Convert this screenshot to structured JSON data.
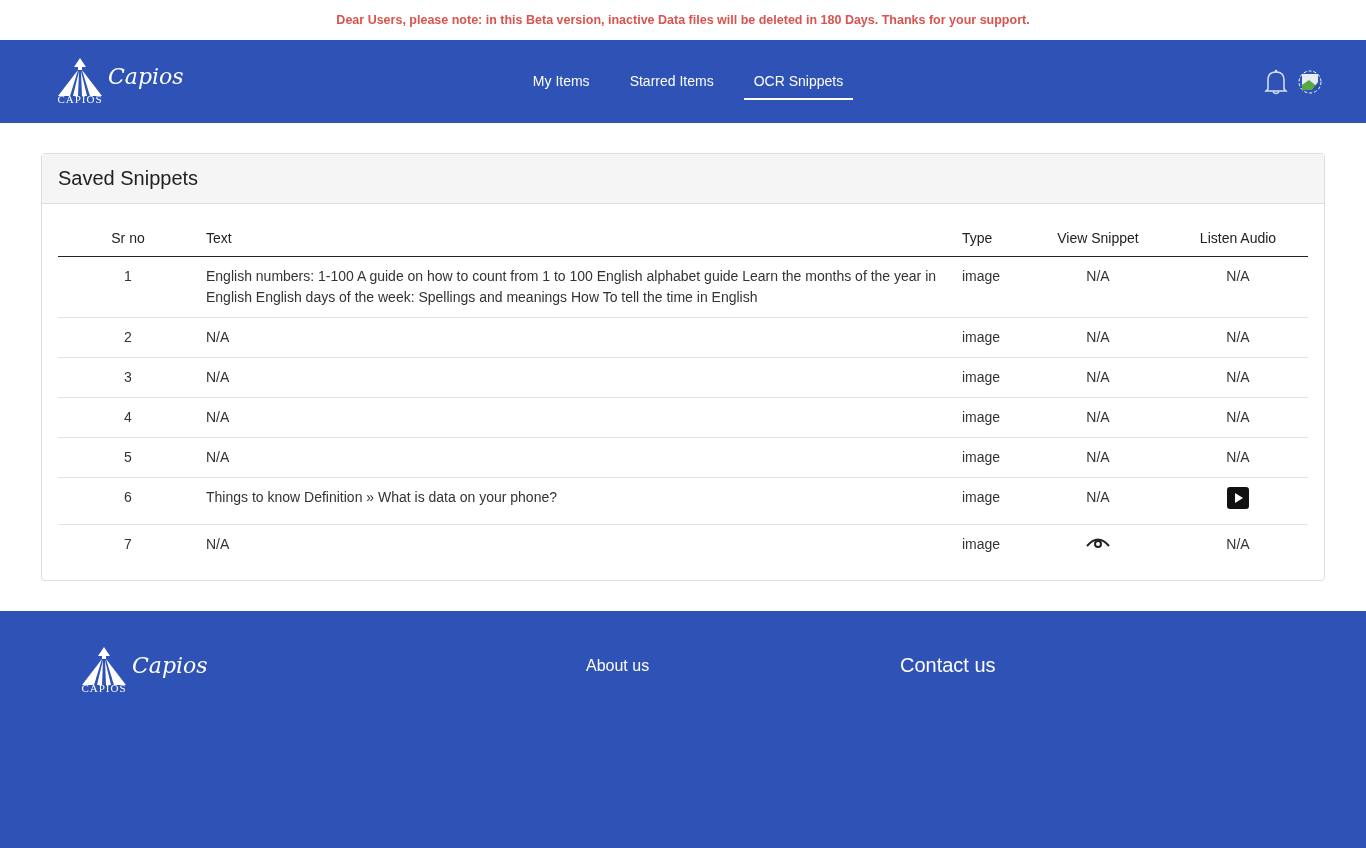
{
  "notice": "Dear Users, please note: in this Beta version, inactive Data files will be deleted in 180 Days. Thanks for your support.",
  "header": {
    "logo": {
      "caption": "CAPIOS",
      "script": "Capios"
    },
    "nav": [
      {
        "label": "My Items",
        "selected": false
      },
      {
        "label": "Starred Items",
        "selected": false
      },
      {
        "label": "OCR Snippets",
        "selected": true
      }
    ]
  },
  "card": {
    "title": "Saved Snippets",
    "columns": [
      "Sr no",
      "Text",
      "Type",
      "View Snippet",
      "Listen Audio"
    ],
    "rows": [
      {
        "sr": "1",
        "text": "English numbers: 1-100 A guide on how to count from 1 to 100 English alphabet guide Learn the months of the year in English English days of the week: Spellings and meanings How To tell the time in English",
        "type": "image",
        "view": {
          "kind": "text",
          "text": "N/A"
        },
        "audio": {
          "kind": "text",
          "text": "N/A"
        }
      },
      {
        "sr": "2",
        "text": "N/A",
        "type": "image",
        "view": {
          "kind": "text",
          "text": "N/A"
        },
        "audio": {
          "kind": "text",
          "text": "N/A"
        }
      },
      {
        "sr": "3",
        "text": "N/A",
        "type": "image",
        "view": {
          "kind": "text",
          "text": "N/A"
        },
        "audio": {
          "kind": "text",
          "text": "N/A"
        }
      },
      {
        "sr": "4",
        "text": "N/A",
        "type": "image",
        "view": {
          "kind": "text",
          "text": "N/A"
        },
        "audio": {
          "kind": "text",
          "text": "N/A"
        }
      },
      {
        "sr": "5",
        "text": "N/A",
        "type": "image",
        "view": {
          "kind": "text",
          "text": "N/A"
        },
        "audio": {
          "kind": "text",
          "text": "N/A"
        }
      },
      {
        "sr": "6",
        "text": "Things to know Definition » What is data on your phone?",
        "type": "image",
        "view": {
          "kind": "text",
          "text": "N/A"
        },
        "audio": {
          "kind": "play"
        }
      },
      {
        "sr": "7",
        "text": "N/A",
        "type": "image",
        "view": {
          "kind": "eye"
        },
        "audio": {
          "kind": "text",
          "text": "N/A"
        }
      }
    ]
  },
  "footer": {
    "logo": {
      "caption": "CAPIOS",
      "script": "Capios"
    },
    "about": "About us",
    "contact": "Contact us"
  }
}
